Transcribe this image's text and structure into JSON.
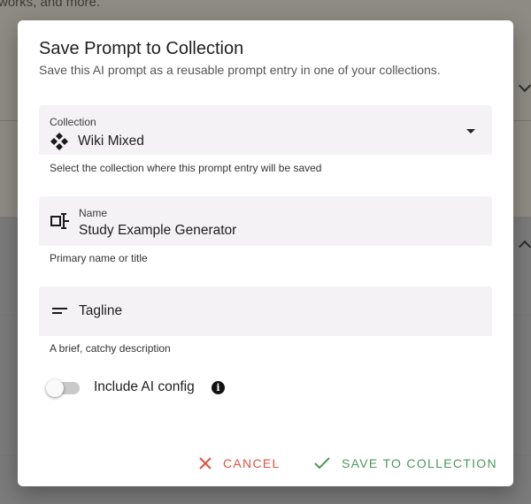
{
  "background": {
    "snippet_text": "works, and more."
  },
  "dialog": {
    "title": "Save Prompt to Collection",
    "subtitle": "Save this AI prompt as a reusable prompt entry in one of your collections.",
    "collection": {
      "label": "Collection",
      "value": "Wiki Mixed",
      "helper": "Select the collection where this prompt entry will be saved",
      "icon": "collection-diamonds-icon"
    },
    "name": {
      "label": "Name",
      "value": "Study Example Generator",
      "helper": "Primary name or title",
      "icon": "text-field-icon"
    },
    "tagline": {
      "placeholder": "Tagline",
      "value": "",
      "helper": "A brief, catchy description",
      "icon": "short-text-icon"
    },
    "include_ai_config": {
      "label": "Include AI config",
      "checked": false,
      "icon": "info-icon"
    },
    "actions": {
      "cancel_label": "CANCEL",
      "save_label": "SAVE TO COLLECTION",
      "cancel_color": "#e0523d",
      "save_color": "#4a9a58"
    }
  }
}
